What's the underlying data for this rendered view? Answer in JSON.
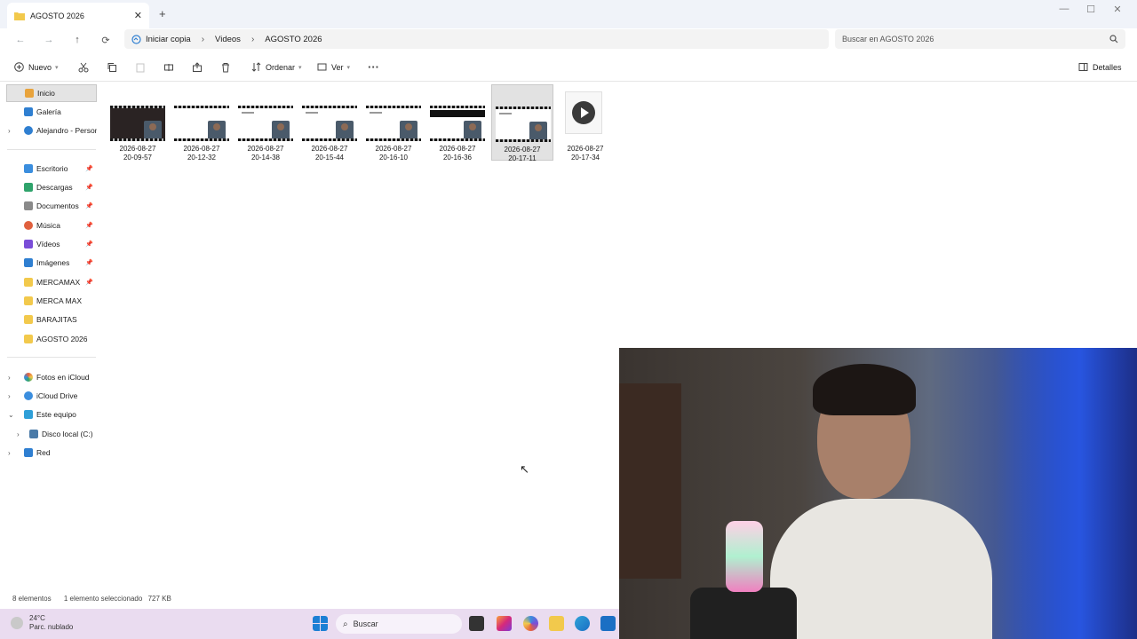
{
  "window": {
    "tab_title": "AGOSTO 2026",
    "new_tab": "+",
    "close": "✕",
    "controls": [
      "—",
      "☐",
      "✕"
    ]
  },
  "nav": {
    "back": "←",
    "forward": "→",
    "up": "↑",
    "refresh": "⟳",
    "breadcrumb": [
      "Iniciar copia",
      "Videos",
      "AGOSTO 2026"
    ],
    "search_placeholder": "Buscar en AGOSTO 2026"
  },
  "toolbar": {
    "new_label": "Nuevo",
    "sort_label": "Ordenar",
    "view_label": "Ver",
    "more": "···",
    "details_label": "Detalles"
  },
  "sidebar": {
    "items": [
      {
        "label": "Inicio",
        "icon": "home-icon",
        "color": "#e8a33c"
      },
      {
        "label": "Galería",
        "icon": "gallery-icon",
        "color": "#2f7fd1"
      },
      {
        "label": "Alejandro - Personal",
        "icon": "onedrive-icon",
        "color": "#2f7fd1"
      },
      {
        "label": "Escritorio",
        "icon": "desktop-icon",
        "color": "#3b8ede"
      },
      {
        "label": "Descargas",
        "icon": "download-icon",
        "color": "#2fa36b"
      },
      {
        "label": "Documentos",
        "icon": "document-icon",
        "color": "#8a8a8a"
      },
      {
        "label": "Música",
        "icon": "music-icon",
        "color": "#e0603e"
      },
      {
        "label": "Vídeos",
        "icon": "video-icon",
        "color": "#7a4dd8"
      },
      {
        "label": "Imágenes",
        "icon": "image-icon",
        "color": "#2f7fd1"
      },
      {
        "label": "MERCAMAX",
        "icon": "folder-icon",
        "color": "#f2c94c"
      },
      {
        "label": "MERCA MAX",
        "icon": "folder-icon",
        "color": "#f2c94c"
      },
      {
        "label": "BARAJITAS",
        "icon": "folder-icon",
        "color": "#f2c94c"
      },
      {
        "label": "AGOSTO 2026",
        "icon": "folder-icon",
        "color": "#f2c94c"
      },
      {
        "label": "Fotos en iCloud",
        "icon": "icloud-photos-icon",
        "color": "#e6603e"
      },
      {
        "label": "iCloud Drive",
        "icon": "icloud-drive-icon",
        "color": "#3b8ede"
      },
      {
        "label": "Este equipo",
        "icon": "computer-icon",
        "color": "#2f9fd8"
      },
      {
        "label": "Disco local (C:)",
        "icon": "drive-icon",
        "color": "#4a7aa8"
      },
      {
        "label": "Red",
        "icon": "network-icon",
        "color": "#2f7fd1"
      }
    ]
  },
  "files": [
    {
      "line1": "2026-08-27",
      "line2": "20-09-57"
    },
    {
      "line1": "2026-08-27",
      "line2": "20-12-32"
    },
    {
      "line1": "2026-08-27",
      "line2": "20-14-38"
    },
    {
      "line1": "2026-08-27",
      "line2": "20-15-44"
    },
    {
      "line1": "2026-08-27",
      "line2": "20-16-10"
    },
    {
      "line1": "2026-08-27",
      "line2": "20-16-36"
    },
    {
      "line1": "2026-08-27",
      "line2": "20-17-11"
    },
    {
      "line1": "2026-08-27",
      "line2": "20-17-34"
    }
  ],
  "status": {
    "count": "8 elementos",
    "selection": "1 elemento seleccionado",
    "size": "727 KB"
  },
  "taskbar": {
    "temperature": "24°C",
    "condition": "Parc. nublado",
    "search_label": "Buscar"
  }
}
